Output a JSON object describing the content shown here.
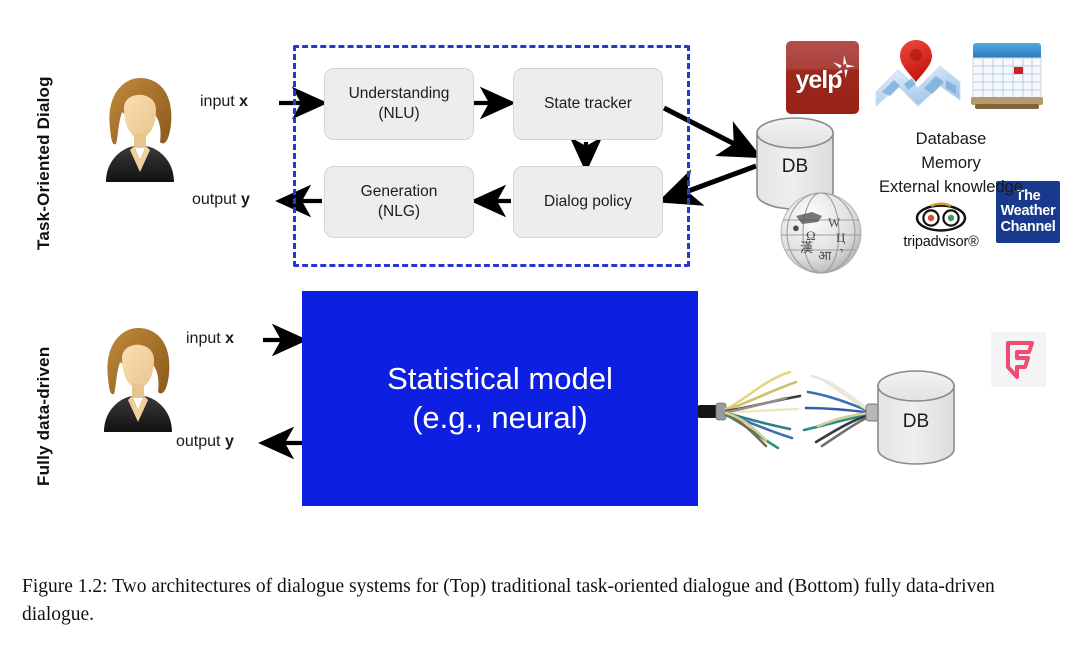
{
  "figure": {
    "caption": "Figure 1.2: Two architectures of dialogue systems for (Top) traditional task-oriented dialogue and (Bottom) fully data-driven dialogue.",
    "caption_number": "Figure 1.2:"
  },
  "colors": {
    "dashed_border": "#2a35d6",
    "module_fill": "#ededed",
    "module_border": "#cfd4dc",
    "statistical_model_fill": "#0d1fe0",
    "statistical_model_text": "#ffffff",
    "arrow": "#000000",
    "db_fill": "#ebebeb",
    "db_border": "#8a8a8a",
    "yelp_red": "#9d2a20",
    "weather_blue": "#19398c",
    "foursquare_pink": "#ef4b73",
    "map_pin_red": "#d41f16"
  },
  "top_section": {
    "side_label": "Task-Oriented Dialog",
    "user_avatar": "user-avatar-icon",
    "input_label": "input",
    "input_var": "x",
    "output_label": "output",
    "output_var": "y",
    "modules": [
      {
        "id": "nlu",
        "line1": "Understanding",
        "line2": "(NLU)"
      },
      {
        "id": "state",
        "line1": "State tracker",
        "line2": ""
      },
      {
        "id": "nlg",
        "line1": "Generation",
        "line2": "(NLG)"
      },
      {
        "id": "policy",
        "line1": "Dialog policy",
        "line2": ""
      }
    ],
    "db_label": "DB",
    "knowledge_lines": [
      "Database",
      "Memory",
      "External knowledge"
    ],
    "logos": [
      {
        "id": "yelp",
        "name": "yelp-logo",
        "text": "yelp"
      },
      {
        "id": "map",
        "name": "map-pin-logo",
        "text": ""
      },
      {
        "id": "calendar",
        "name": "calendar-logo",
        "text": ""
      },
      {
        "id": "weather",
        "name": "weather-channel-logo",
        "line1": "The",
        "line2": "Weather",
        "line3": "Channel"
      },
      {
        "id": "wikipedia",
        "name": "wikipedia-globe-logo",
        "text": ""
      },
      {
        "id": "tripadvisor",
        "name": "tripadvisor-logo",
        "text": "tripadvisor®"
      },
      {
        "id": "foursquare",
        "name": "foursquare-logo",
        "text": "F"
      }
    ]
  },
  "bottom_section": {
    "side_label": "Fully data-driven",
    "user_avatar": "user-avatar-icon",
    "input_label": "input",
    "input_var": "x",
    "output_label": "output",
    "output_var": "y",
    "model_line1": "Statistical model",
    "model_line2": "(e.g., neural)",
    "db_label": "DB",
    "cable_icon": "frayed-cable-bundle-icon"
  }
}
